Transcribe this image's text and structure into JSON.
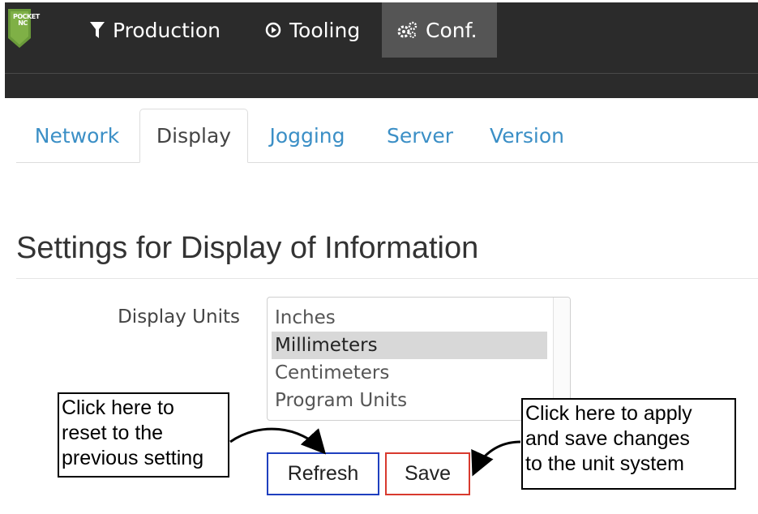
{
  "logo": {
    "text": "POCKET NC"
  },
  "nav": {
    "items": [
      {
        "label": "Production",
        "icon": "filter-icon"
      },
      {
        "label": "Tooling",
        "icon": "play-circle-icon"
      },
      {
        "label": "Conf.",
        "icon": "gears-icon",
        "active": true
      }
    ]
  },
  "tabs": [
    {
      "label": "Network"
    },
    {
      "label": "Display",
      "active": true
    },
    {
      "label": "Jogging"
    },
    {
      "label": "Server"
    },
    {
      "label": "Version"
    }
  ],
  "page": {
    "title": "Settings for Display of Information"
  },
  "form": {
    "display_units_label": "Display Units",
    "options": [
      "Inches",
      "Millimeters",
      "Centimeters",
      "Program Units"
    ],
    "selected": "Millimeters"
  },
  "buttons": {
    "refresh": "Refresh",
    "save": "Save"
  },
  "annotations": {
    "left": [
      "Click here to",
      "reset to the",
      "previous setting"
    ],
    "right": [
      "Click here to apply",
      "and save changes",
      "to the unit system"
    ]
  },
  "colors": {
    "navbar": "#2b2b2b",
    "nav_active": "#555555",
    "tab_link": "#3b8fc6",
    "refresh_border": "#1f3fbf",
    "save_border": "#d83a2e",
    "logo_green": "#6a9a3a"
  }
}
